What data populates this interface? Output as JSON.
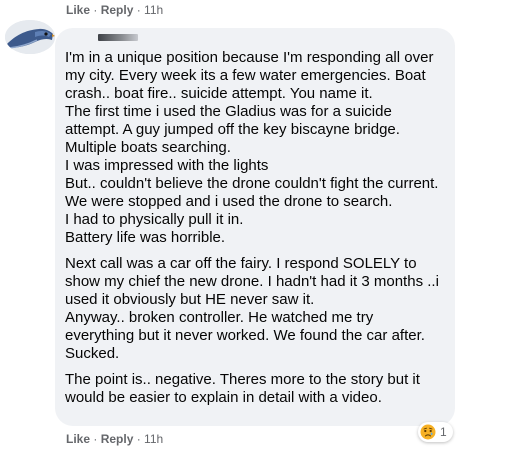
{
  "top_actions": {
    "like": "Like",
    "separator": " · ",
    "reply": "Reply",
    "time": "11h"
  },
  "comment": {
    "paragraphs": [
      "I'm in a unique position because I'm responding all over my city. Every week its a few water emergencies. Boat crash.. boat fire.. suicide attempt. You name it.\nThe first time i used the Gladius was for a suicide attempt. A guy jumped off the key biscayne bridge. Multiple boats searching.\nI was impressed with the lights\nBut.. couldn't believe the drone couldn't fight the current.\nWe were stopped and i used the drone to search.\nI had to physically pull it in.\nBattery life was horrible.",
      "Next call was a car off the fairy. I respond SOLELY to show my chief the new drone. I hadn't had it 3 months ..i used it obviously but HE never saw it.\nAnyway.. broken controller. He watched me try everything but it never worked. We found the car after.\nSucked.",
      "The point is.. negative. Theres more to the story but it would be easier to explain in detail with a video."
    ]
  },
  "reactions": {
    "icon": "sad-reaction-icon",
    "count": "1",
    "color": "#f7b125"
  },
  "bottom_actions": {
    "like": "Like",
    "separator": " · ",
    "reply": "Reply",
    "time": "11h"
  }
}
